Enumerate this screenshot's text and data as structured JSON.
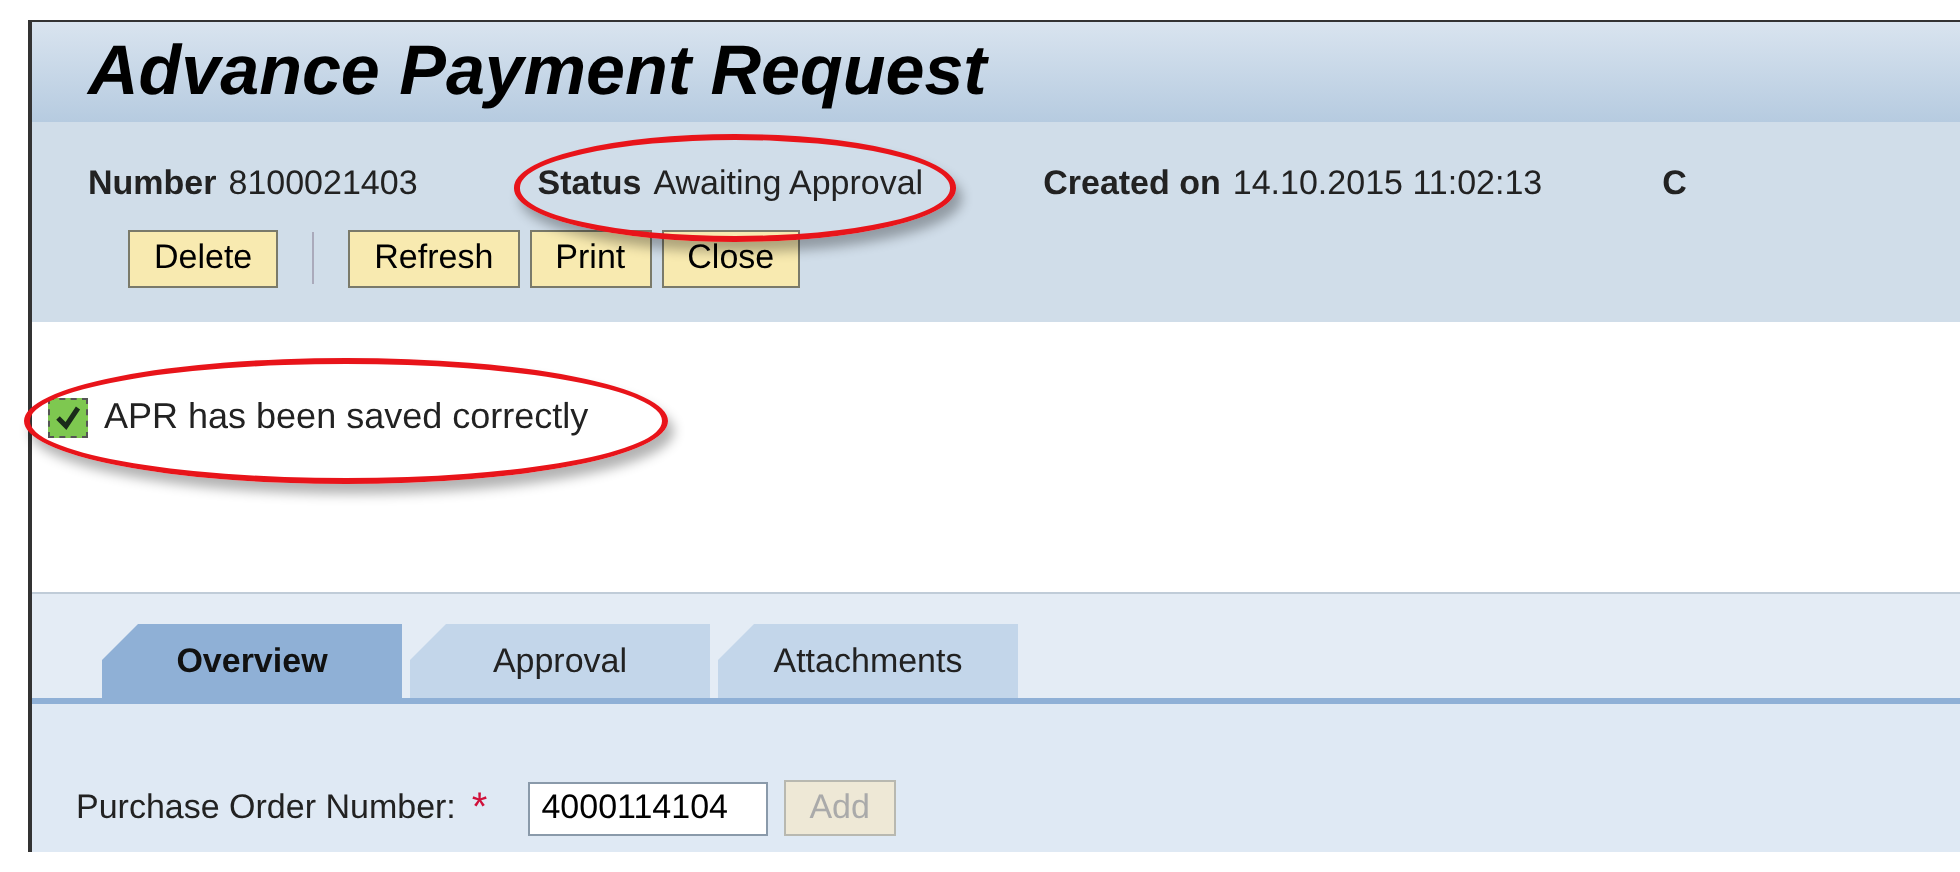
{
  "window": {
    "title": "Advance Payment Request"
  },
  "header": {
    "fields": [
      {
        "label": "Number",
        "value": "8100021403",
        "circled": false
      },
      {
        "label": "Status",
        "value": "Awaiting Approval",
        "circled": true
      },
      {
        "label": "Created on",
        "value": "14.10.2015 11:02:13",
        "circled": false
      },
      {
        "label": "C",
        "circled": false
      }
    ]
  },
  "toolbar": {
    "buttons": [
      {
        "label": "Delete",
        "separator_after": true
      },
      {
        "label": "Refresh",
        "separator_after": false
      },
      {
        "label": "Print",
        "separator_after": false
      },
      {
        "label": "Close",
        "separator_after": false
      }
    ]
  },
  "message": {
    "text": "APR has been saved correctly",
    "circled": true
  },
  "tabs": [
    {
      "label": "Overview",
      "selected": true
    },
    {
      "label": "Approval",
      "selected": false
    },
    {
      "label": "Attachments",
      "selected": false
    }
  ],
  "form": {
    "label": "Purchase Order Number:",
    "required_mark": "*",
    "value": "4000114104",
    "button": {
      "label": "Add",
      "disabled": true
    }
  }
}
